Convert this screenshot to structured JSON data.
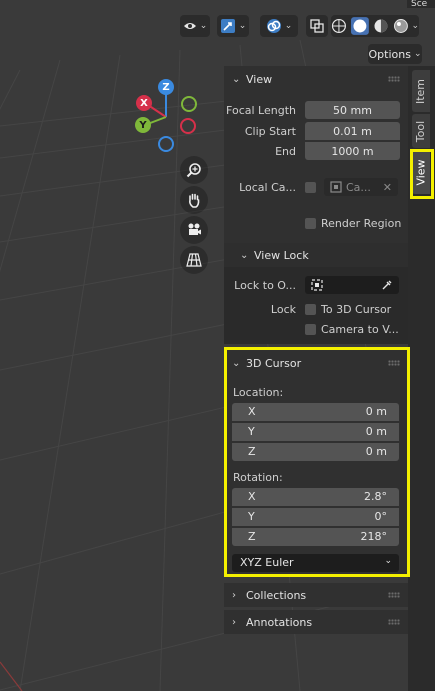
{
  "header": {
    "top_right_text": "Sce",
    "options_label": "Options",
    "icons": [
      "visibility-icon",
      "gizmo-icon",
      "overlay-icon",
      "xray-icon",
      "wireframe-shading-icon",
      "solid-shading-icon",
      "material-shading-icon",
      "rendered-shading-icon"
    ]
  },
  "gizmo": {
    "z": "Z",
    "x": "X",
    "y": "Y"
  },
  "tabs": {
    "item": "Item",
    "tool": "Tool",
    "view": "View"
  },
  "view_panel": {
    "title": "View",
    "focal_length_label": "Focal Length",
    "focal_length_value": "50 mm",
    "clip_start_label": "Clip Start",
    "clip_start_value": "0.01 m",
    "end_label": "End",
    "end_value": "1000 m",
    "local_camera_label": "Local Ca...",
    "local_camera_value": "Ca...",
    "render_region_label": "Render Region"
  },
  "view_lock": {
    "title": "View Lock",
    "lock_to_object_label": "Lock to O...",
    "lock_label": "Lock",
    "to_3d_cursor_label": "To 3D Cursor",
    "camera_to_view_label": "Camera to V..."
  },
  "cursor_panel": {
    "title": "3D Cursor",
    "location_label": "Location:",
    "location": [
      {
        "axis": "X",
        "value": "0 m"
      },
      {
        "axis": "Y",
        "value": "0 m"
      },
      {
        "axis": "Z",
        "value": "0 m"
      }
    ],
    "rotation_label": "Rotation:",
    "rotation": [
      {
        "axis": "X",
        "value": "2.8°"
      },
      {
        "axis": "Y",
        "value": "0°"
      },
      {
        "axis": "Z",
        "value": "218°"
      }
    ],
    "rotation_mode": "XYZ Euler"
  },
  "collections_panel": {
    "title": "Collections"
  },
  "annotations_panel": {
    "title": "Annotations"
  },
  "colors": {
    "highlight": "#f4f000",
    "x_axis": "#d6304a",
    "y_axis": "#7fb83a",
    "z_axis": "#3a8ae0"
  }
}
